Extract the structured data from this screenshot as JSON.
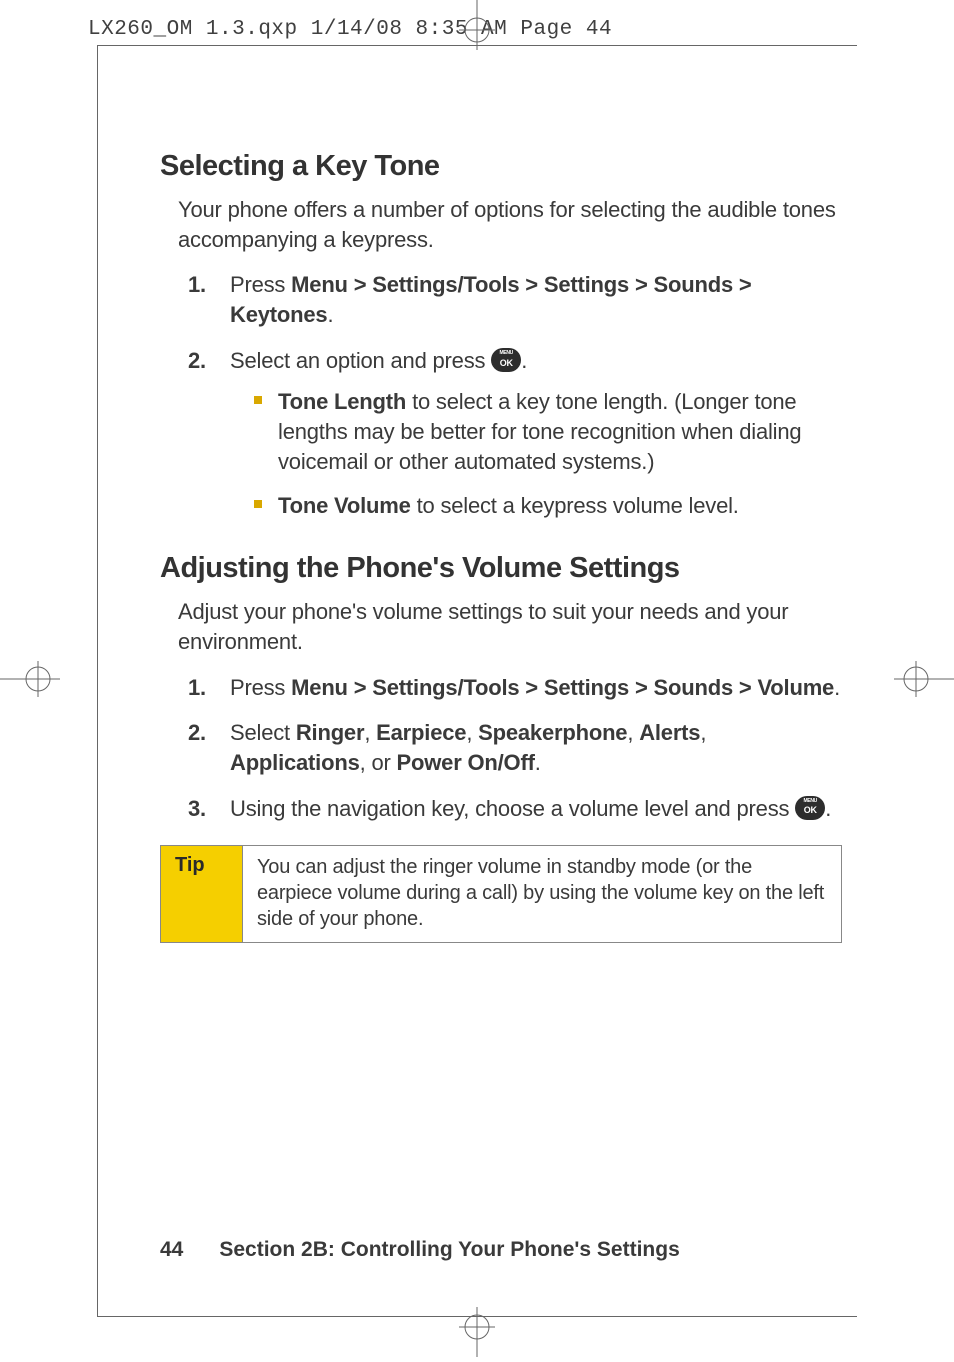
{
  "slug": "LX260_OM 1.3.qxp  1/14/08  8:35 AM  Page 44",
  "heading1": "Selecting a Key Tone",
  "intro1": "Your phone offers a number of options for selecting the audible tones accompanying a keypress.",
  "s1_step1_a": "Press ",
  "s1_step1_b": "Menu > Settings/Tools > Settings > Sounds > Keytones",
  "s1_step1_c": ".",
  "s1_step2_a": "Select an option and press ",
  "s1_step2_c": ".",
  "bullet1_b": "Tone Length",
  "bullet1_t": " to select a key tone length. (Longer tone lengths may be better for tone recognition when dialing voicemail or other automated systems.)",
  "bullet2_b": "Tone Volume",
  "bullet2_t": " to select a keypress volume level.",
  "heading2": "Adjusting the Phone's Volume Settings",
  "intro2": "Adjust your phone's volume settings to suit your needs and your environment.",
  "s2_step1_a": "Press ",
  "s2_step1_b": "Menu > Settings/Tools > Settings > Sounds > Volume",
  "s2_step1_c": ".",
  "s2_step2_a": "Select ",
  "s2_step2_b1": "Ringer",
  "s2_step2_s1": ", ",
  "s2_step2_b2": "Earpiece",
  "s2_step2_s2": ", ",
  "s2_step2_b3": "Speakerphone",
  "s2_step2_s3": ", ",
  "s2_step2_b4": "Alerts",
  "s2_step2_s4": ", ",
  "s2_step2_b5": "Applications",
  "s2_step2_s5": ", or ",
  "s2_step2_b6": "Power On/Off",
  "s2_step2_c": ".",
  "s2_step3_a": "Using the navigation key, choose a volume level and press ",
  "s2_step3_c": ".",
  "tip_label": "Tip",
  "tip_text": "You can adjust the ringer volume in standby mode (or the earpiece volume during a call) by using the volume key on the left side of your phone.",
  "page_number": "44",
  "footer_section": "Section 2B: Controlling Your Phone's Settings",
  "ok_top": "MENU",
  "ok_bot": "OK"
}
